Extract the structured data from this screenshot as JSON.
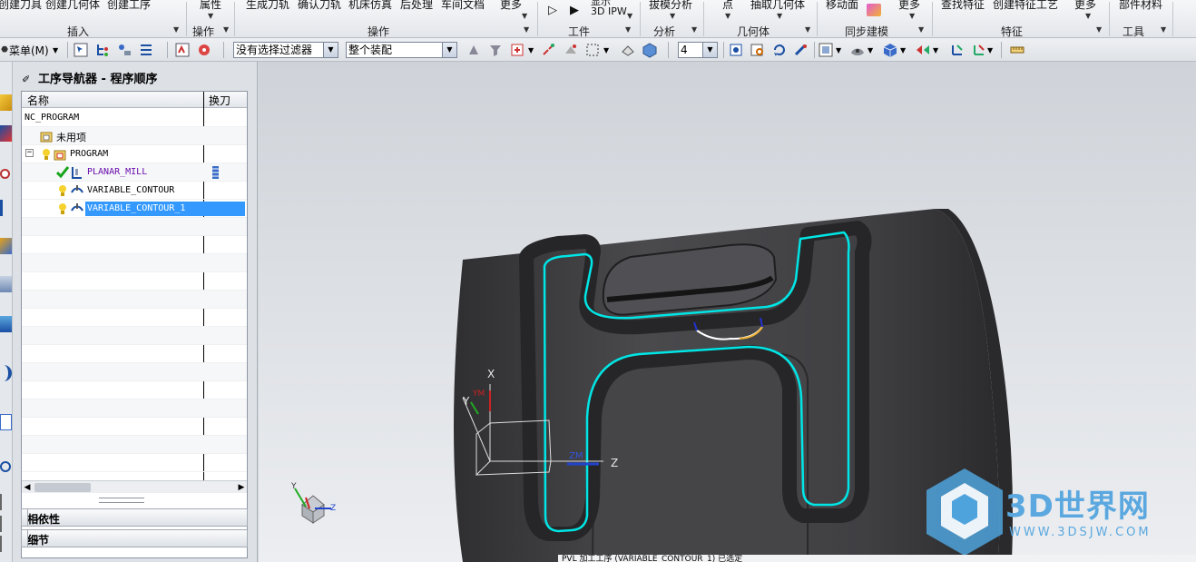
{
  "ribbon": {
    "buttons": {
      "create_tool": "创建刀具",
      "create_geometry": "创建几何体",
      "create_operation": "创建工序",
      "properties": "属性",
      "generate_toolpath": "生成刀轨",
      "verify_toolpath": "确认刀轨",
      "machine_simulation": "机床仿真",
      "postprocess": "后处理",
      "shop_doc": "车间文档",
      "more1": "更多",
      "display_3d_ipw": "显示 3D IPW",
      "draft_analysis": "拔模分析",
      "point": "点",
      "extract_geometry": "抽取几何体",
      "move_face": "移动面",
      "more2": "更多",
      "find_features": "查找特征",
      "create_feature_process": "创建特征工艺",
      "more3": "更多",
      "part_material": "部件材料"
    },
    "groups": {
      "insert": "插入",
      "operation_small": "操作",
      "operation": "操作",
      "workpiece": "工件",
      "analysis": "分析",
      "geometry": "几何体",
      "sync_modeling": "同步建模",
      "feature": "特征",
      "tools": "工具"
    }
  },
  "toolbar": {
    "menu_label": "菜单(M)",
    "filter_value": "没有选择过滤器",
    "assembly_value": "整个装配",
    "layer_value": "4"
  },
  "navigator": {
    "title": "工序导航器 - 程序顺序",
    "col_name": "名称",
    "col_tool_change": "换刀",
    "rows": [
      {
        "label": "NC_PROGRAM"
      },
      {
        "label": "未用项"
      },
      {
        "label": "PROGRAM"
      },
      {
        "label": "PLANAR_MILL"
      },
      {
        "label": "VARIABLE_CONTOUR"
      },
      {
        "label": "VARIABLE_CONTOUR_1"
      }
    ],
    "sections": {
      "dependencies": "相依性",
      "details": "细节"
    }
  },
  "viewport": {
    "axis": {
      "x": "X",
      "y": "Y",
      "z": "Z",
      "zm": "ZM",
      "ym": "YM"
    },
    "triad": {
      "y": "Y",
      "z": "Z"
    },
    "toolpath_color": "#00e5e5",
    "part_color": "#3c3c3e"
  },
  "status_text": "PVL 加工工序 (VARIABLE_CONTOUR_1) 已选定",
  "watermark": {
    "brand": "3D世界网",
    "url": "WWW.3DSJW.COM"
  }
}
